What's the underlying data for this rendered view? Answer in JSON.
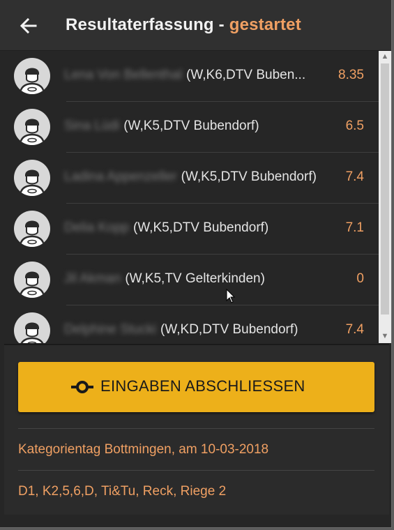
{
  "header": {
    "title": "Resultaterfassung - ",
    "status": "gestartet",
    "back_icon": "arrow-left-icon"
  },
  "list": {
    "rows": [
      {
        "name": "Lena Von Bellenthal",
        "details": "(W,K6,DTV Buben...",
        "score": "8.35"
      },
      {
        "name": "Sina Lüdi",
        "details": "(W,K5,DTV Bubendorf)",
        "score": "6.5"
      },
      {
        "name": "Ladina Appenzeller",
        "details": "(W,K5,DTV Bubendorf)",
        "score": "7.4"
      },
      {
        "name": "Delia Kopp",
        "details": "(W,K5,DTV Bubendorf)",
        "score": "7.1"
      },
      {
        "name": "Jil Akman",
        "details": "(W,K5,TV Gelterkinden)",
        "score": "0"
      },
      {
        "name": "Delphine Stucki",
        "details": "(W,KD,DTV Bubendorf)",
        "score": "7.4"
      }
    ]
  },
  "footer": {
    "button_label": "EINGABEN ABSCHLIESSEN",
    "button_icon": "commit-icon",
    "event": "Kategorientag Bottmingen, am 10-03-2018",
    "group": "D1, K2,5,6,D, Ti&Tu, Reck, Riege 2"
  },
  "colors": {
    "accent": "#f0a063",
    "button": "#edb01a",
    "background": "#262626",
    "header": "#303030"
  }
}
